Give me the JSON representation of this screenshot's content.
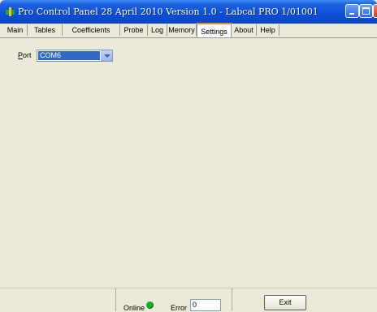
{
  "window": {
    "title": "Pro Control Panel 28 April 2010 Version 1.0 - Labcal PRO 1/01001",
    "colors": {
      "titlebar": "#0b4fd6",
      "close": "#c8411f",
      "face": "#ece9d8"
    }
  },
  "tabs": [
    {
      "label": "Main",
      "active": false
    },
    {
      "label": "Tables",
      "active": false
    },
    {
      "label": "Coefficients",
      "active": false
    },
    {
      "label": "Probe",
      "active": false
    },
    {
      "label": "Log",
      "active": false
    },
    {
      "label": "Memory",
      "active": false
    },
    {
      "label": "Settings",
      "active": true
    },
    {
      "label": "About",
      "active": false
    },
    {
      "label": "Help",
      "active": false
    }
  ],
  "settings": {
    "port_label_accel": "P",
    "port_label_rest": "ort",
    "port_value": "COM6"
  },
  "status": {
    "online_label": "Online",
    "online_color": "#15b02f",
    "error_label": "Error",
    "error_value": "0",
    "exit_label": "Exit"
  }
}
